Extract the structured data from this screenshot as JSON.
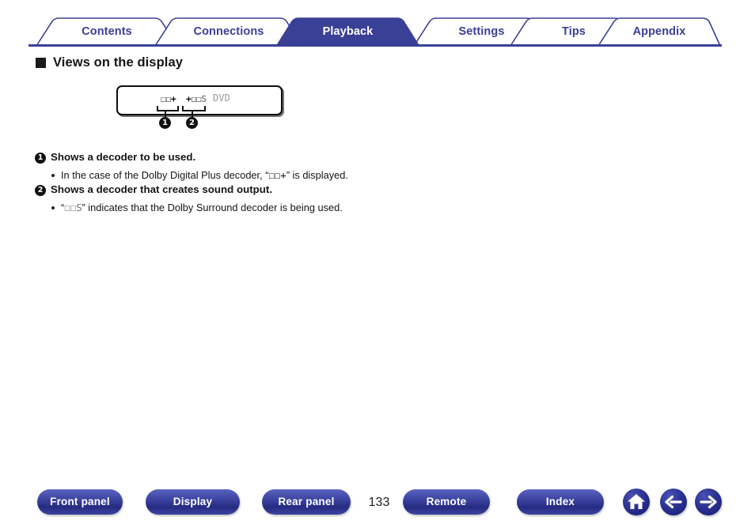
{
  "nav_tabs": [
    {
      "label": "Contents",
      "active": false
    },
    {
      "label": "Connections",
      "active": false
    },
    {
      "label": "Playback",
      "active": true
    },
    {
      "label": "Settings",
      "active": false
    },
    {
      "label": "Tips",
      "active": false
    },
    {
      "label": "Appendix",
      "active": false
    }
  ],
  "heading": {
    "bullet_icon": "filled-square-icon",
    "text": "Views on the display"
  },
  "figure": {
    "panel_name": "front-panel-display",
    "lcd": {
      "decoder_in": "☐☐+",
      "decoder_out_active": "+☐☐",
      "decoder_out_dim": "S",
      "source_indicator": "DVD"
    },
    "callouts": [
      {
        "id": "1",
        "marker": "❶"
      },
      {
        "id": "2",
        "marker": "❷"
      }
    ]
  },
  "items": [
    {
      "marker": "1",
      "title": "Shows a decoder to be used.",
      "bullet_prefix": "In the case of the Dolby Digital Plus decoder, “",
      "bullet_glyph": "☐☐+",
      "bullet_suffix": "” is displayed."
    },
    {
      "marker": "2",
      "title": "Shows a decoder that creates sound output.",
      "bullet_prefix": "“",
      "bullet_glyph": "☐☐S",
      "bullet_suffix": "” indicates that the Dolby Surround decoder is being used."
    }
  ],
  "footer": {
    "buttons": [
      {
        "label": "Front panel"
      },
      {
        "label": "Display"
      },
      {
        "label": "Rear panel"
      },
      {
        "label": "Remote"
      },
      {
        "label": "Index"
      }
    ],
    "page_number": "133",
    "nav_icons": [
      {
        "name": "home-icon"
      },
      {
        "name": "arrow-left-icon"
      },
      {
        "name": "arrow-right-icon"
      }
    ]
  },
  "colors": {
    "brand_blue": "#3a4096",
    "tab_active_fill": "#3a4096",
    "tab_text": "#3a4096",
    "lcd_dim": "#9a9a9a"
  }
}
